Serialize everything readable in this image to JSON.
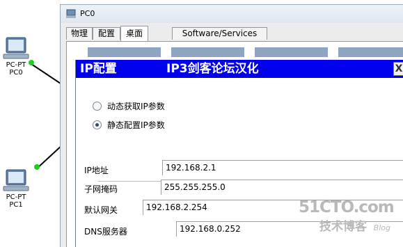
{
  "workspace": {
    "devices": [
      {
        "type": "PC-PT",
        "name": "PC0"
      },
      {
        "type": "PC-PT",
        "name": "PC1"
      }
    ],
    "link_color": "#1fcf1f"
  },
  "window": {
    "title": "PC0",
    "tabs": [
      {
        "label": "物理",
        "active": false
      },
      {
        "label": "配置",
        "active": false
      },
      {
        "label": "桌面",
        "active": true
      },
      {
        "label": "Software/Services",
        "active": false
      }
    ]
  },
  "ip_config": {
    "title": "IP配置",
    "subtitle": "IP3剑客论坛汉化",
    "close_label": "X",
    "header_color": "#0000ee",
    "mode_options": [
      {
        "label": "动态获取IP参数",
        "selected": false
      },
      {
        "label": "静态配置IP参数",
        "selected": true
      }
    ],
    "fields": {
      "ip_label": "IP地址",
      "ip_value": "192.168.2.1",
      "mask_label": "子网掩码",
      "mask_value": "255.255.255.0",
      "gateway_label": "默认网关",
      "gateway_value": "192.168.2.254",
      "dns_label": "DNS服务器",
      "dns_value": "192.168.0.252"
    }
  },
  "watermark": {
    "main": "51CTO.com",
    "sub": "技术博客",
    "blog": "Blog"
  }
}
